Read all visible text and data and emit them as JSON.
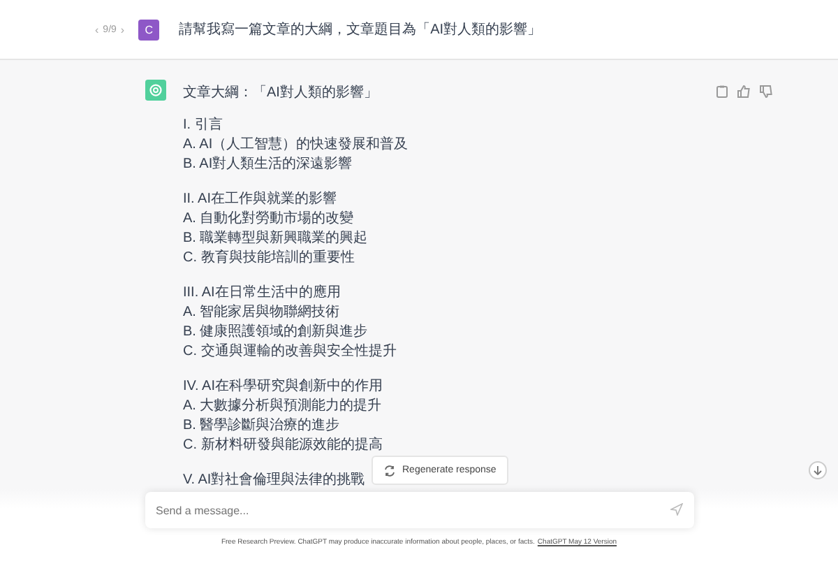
{
  "user_message": {
    "pager": {
      "prev": "‹",
      "count": "9/9",
      "next": "›"
    },
    "avatar": "C",
    "text": "請幫我寫一篇文章的大綱，文章題目為「AI對人類的影響」"
  },
  "assistant_message": {
    "title": "文章大綱：「AI對人類的影響」",
    "sections": [
      {
        "heading": "I. 引言",
        "items": [
          "A. AI（人工智慧）的快速發展和普及",
          "B. AI對人類生活的深遠影響"
        ]
      },
      {
        "heading": "II. AI在工作與就業的影響",
        "items": [
          "A. 自動化對勞動市場的改變",
          "B. 職業轉型與新興職業的興起",
          "C. 教育與技能培訓的重要性"
        ]
      },
      {
        "heading": "III. AI在日常生活中的應用",
        "items": [
          "A. 智能家居與物聯網技術",
          "B. 健康照護領域的創新與進步",
          "C. 交通與運輸的改善與安全性提升"
        ]
      },
      {
        "heading": "IV. AI在科學研究與創新中的作用",
        "items": [
          "A. 大數據分析與預測能力的提升",
          "B. 醫學診斷與治療的進步",
          "C. 新材料研發與能源效能的提高"
        ]
      },
      {
        "heading": "V. AI對社會倫理與法律的挑戰"
      }
    ]
  },
  "regenerate_button": "Regenerate response",
  "composer": {
    "placeholder": "Send a message..."
  },
  "footer": {
    "text": "Free Research Preview. ChatGPT may produce inaccurate information about people, places, or facts.",
    "link": "ChatGPT May 12 Version"
  }
}
